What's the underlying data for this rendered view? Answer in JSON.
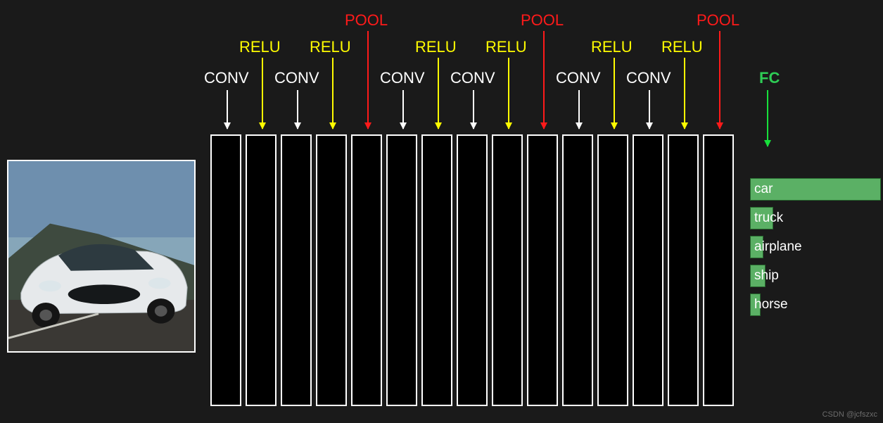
{
  "labels": {
    "conv": "CONV",
    "relu": "RELU",
    "pool": "POOL",
    "fc": "FC"
  },
  "layer_sequence": [
    {
      "type": "conv",
      "x": 322
    },
    {
      "type": "relu",
      "x": 372
    },
    {
      "type": "conv",
      "x": 422
    },
    {
      "type": "relu",
      "x": 472
    },
    {
      "type": "pool",
      "x": 522
    },
    {
      "type": "conv",
      "x": 572
    },
    {
      "type": "relu",
      "x": 622
    },
    {
      "type": "conv",
      "x": 672
    },
    {
      "type": "relu",
      "x": 722
    },
    {
      "type": "pool",
      "x": 772
    },
    {
      "type": "conv",
      "x": 822
    },
    {
      "type": "relu",
      "x": 872
    },
    {
      "type": "conv",
      "x": 922
    },
    {
      "type": "relu",
      "x": 972
    },
    {
      "type": "pool",
      "x": 1022
    }
  ],
  "fc": {
    "x": 1090
  },
  "activation_rows": 10,
  "column_styles": [
    "gray-blur",
    "dark-edges",
    "gray-blur",
    "dark-edges",
    "dark-edges",
    "dark-edges",
    "dark-edges",
    "gray-blur",
    "dark-edges",
    "dark-edges",
    "gray-pixel",
    "dark-edges",
    "gray-pixel",
    "dark-pixel",
    "dark-pixel"
  ],
  "chart_data": {
    "type": "bar",
    "orientation": "horizontal",
    "title": "",
    "xlim": [
      0,
      1
    ],
    "categories": [
      "car",
      "truck",
      "airplane",
      "ship",
      "horse"
    ],
    "values": [
      1.0,
      0.18,
      0.1,
      0.12,
      0.08
    ]
  },
  "watermark": "CSDN @jcfszxc"
}
